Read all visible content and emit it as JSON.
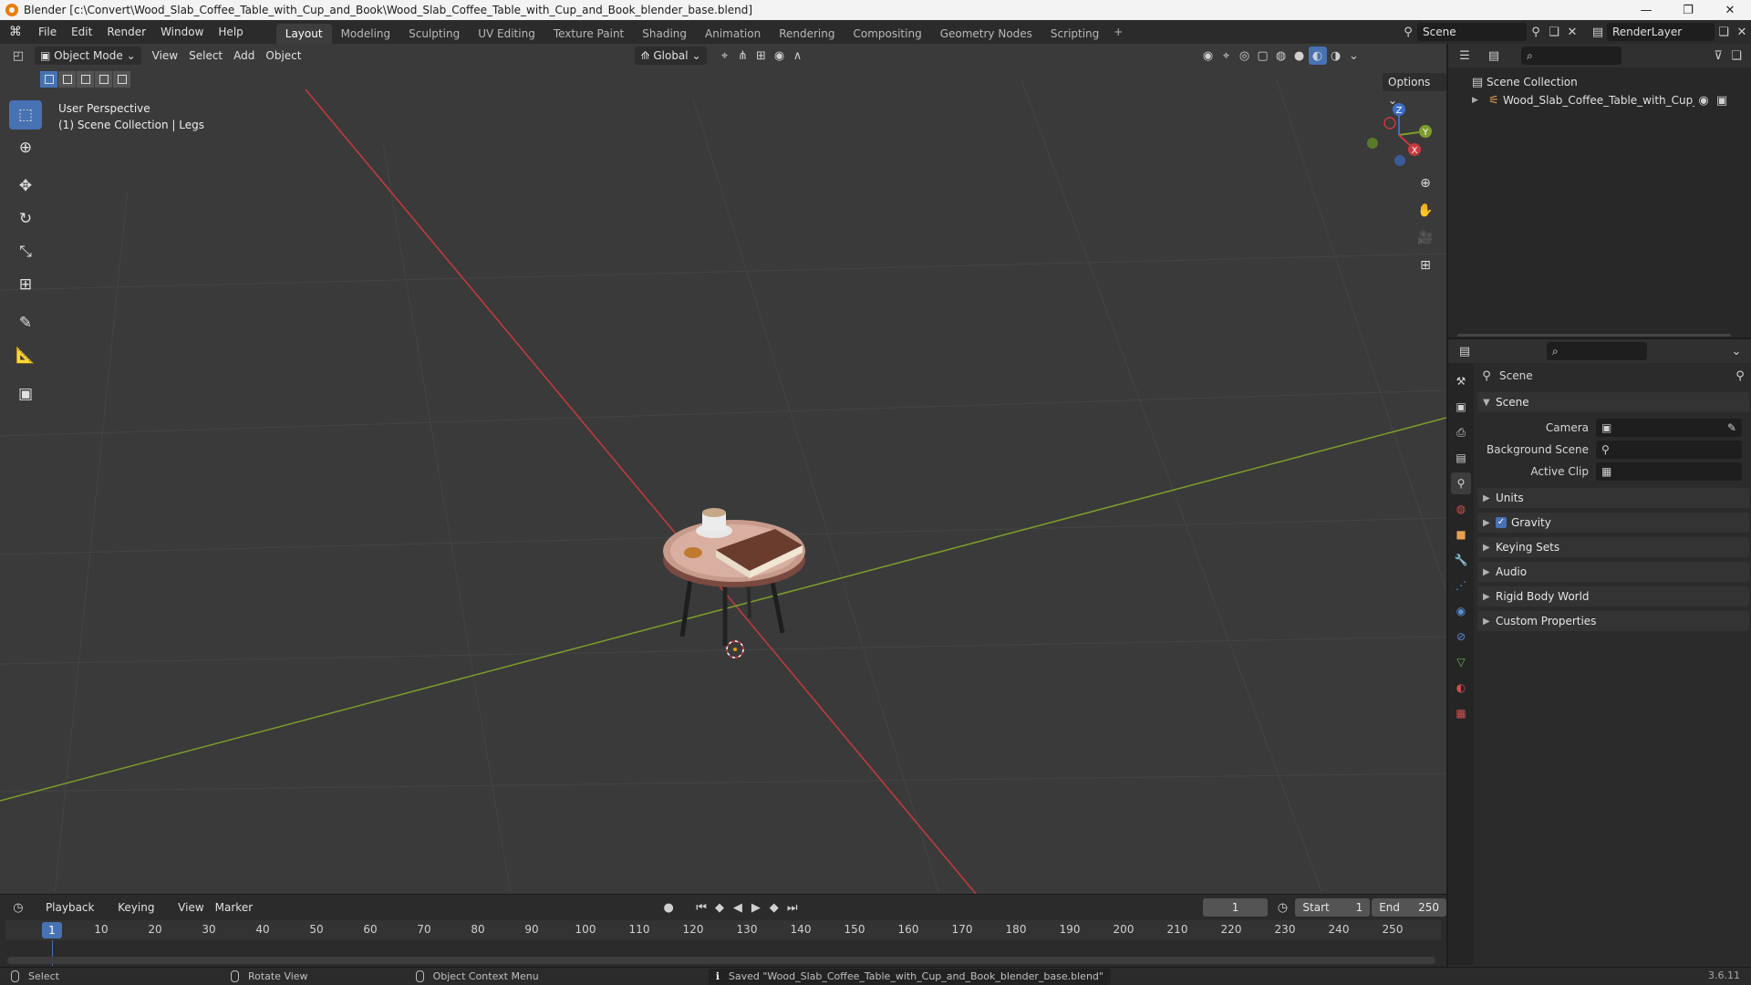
{
  "window": {
    "title": "Blender [c:\\Convert\\Wood_Slab_Coffee_Table_with_Cup_and_Book\\Wood_Slab_Coffee_Table_with_Cup_and_Book_blender_base.blend]",
    "minimize": "—",
    "maximize": "❐",
    "close": "✕"
  },
  "menu": {
    "items": [
      "File",
      "Edit",
      "Render",
      "Window",
      "Help"
    ]
  },
  "workspaces": {
    "tabs": [
      "Layout",
      "Modeling",
      "Sculpting",
      "UV Editing",
      "Texture Paint",
      "Shading",
      "Animation",
      "Rendering",
      "Compositing",
      "Geometry Nodes",
      "Scripting"
    ],
    "add": "+",
    "active": "Layout"
  },
  "scene_selector": {
    "value": "Scene"
  },
  "view_layer_selector": {
    "value": "RenderLayer"
  },
  "viewport": {
    "mode": "Object Mode",
    "menus": [
      "View",
      "Select",
      "Add",
      "Object"
    ],
    "transform_orientation": "Global",
    "options": "Options",
    "perspective_label": "User Perspective",
    "collection_label": "(1) Scene Collection | Legs",
    "gizmo": {
      "x": "X",
      "y": "Y",
      "z": "Z"
    },
    "colors": {
      "x_axis": "#c8393f",
      "y_axis": "#7c9d2c",
      "z_axis": "#3d6fc7",
      "accent": "#4772b3"
    }
  },
  "timeline": {
    "menus": [
      "Playback",
      "Keying",
      "View",
      "Marker"
    ],
    "current_frame": "1",
    "start_label": "Start",
    "start_value": "1",
    "end_label": "End",
    "end_value": "250",
    "ruler": [
      "10",
      "20",
      "30",
      "40",
      "50",
      "60",
      "70",
      "80",
      "90",
      "100",
      "110",
      "120",
      "130",
      "140",
      "150",
      "160",
      "170",
      "180",
      "190",
      "200",
      "210",
      "220",
      "230",
      "240",
      "250"
    ],
    "cursor": "1"
  },
  "statusbar": {
    "select": "Select",
    "rotate": "Rotate View",
    "context": "Object Context Menu",
    "message": "Saved \"Wood_Slab_Coffee_Table_with_Cup_and_Book_blender_base.blend\"",
    "version": "3.6.11"
  },
  "outliner": {
    "root": "Scene Collection",
    "object": "Wood_Slab_Coffee_Table_with_Cup_and"
  },
  "properties": {
    "title": "Scene",
    "scene_panel": "Scene",
    "camera_label": "Camera",
    "background_label": "Background Scene",
    "clip_label": "Active Clip",
    "panels": [
      "Units",
      "Gravity",
      "Keying Sets",
      "Audio",
      "Rigid Body World",
      "Custom Properties"
    ]
  }
}
